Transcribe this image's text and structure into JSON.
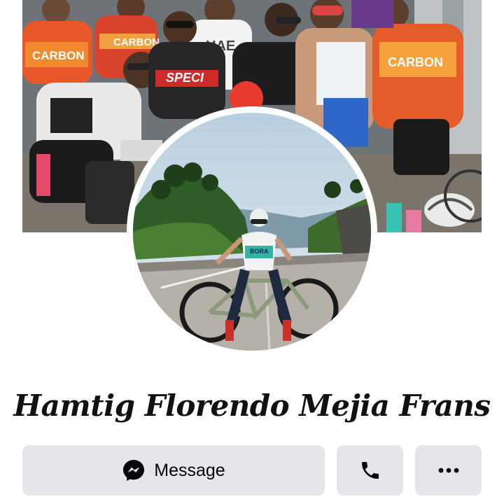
{
  "profile": {
    "name": "Hamtig Florendo Mejia Frans"
  },
  "actions": {
    "message_label": "Message",
    "call_icon": "phone-icon",
    "more_icon": "more-options-icon",
    "message_icon": "messenger-icon"
  },
  "images": {
    "cover": "group-of-cyclists-photo",
    "avatar": "cyclist-with-mountain-bike-photo",
    "cover_jersey_text": [
      "CARBON",
      "CARBON",
      "UAE",
      "SPECI",
      "CARBON"
    ],
    "avatar_jersey_text": "BORA"
  },
  "colors": {
    "button_bg": "#e4e6eb",
    "text": "#050505",
    "background": "#ffffff"
  }
}
